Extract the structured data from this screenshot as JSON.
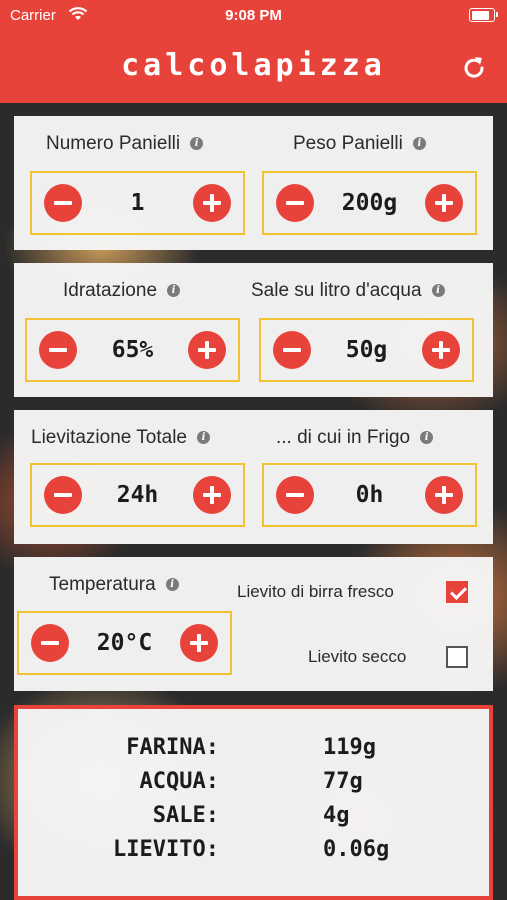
{
  "status_bar": {
    "carrier": "Carrier",
    "time": "9:08 PM",
    "battery_fill": 0.95
  },
  "header": {
    "title": "calcolapizza",
    "refresh_icon": "refresh-icon"
  },
  "settings": {
    "numero_panielli": {
      "label": "Numero Panielli",
      "value": "1"
    },
    "peso_panielli": {
      "label": "Peso Panielli",
      "value": "200g"
    },
    "idratazione": {
      "label": "Idratazione",
      "value": "65%"
    },
    "sale": {
      "label": "Sale su litro d'acqua",
      "value": "50g"
    },
    "lievitazione_totale": {
      "label": "Lievitazione Totale",
      "value": "24h"
    },
    "frigo": {
      "label": "... di cui in Frigo",
      "value": "0h"
    },
    "temperatura": {
      "label": "Temperatura",
      "value": "20°C"
    },
    "lievito_fresco": {
      "label": "Lievito di birra fresco",
      "checked": true
    },
    "lievito_secco": {
      "label": "Lievito secco",
      "checked": false
    }
  },
  "results": [
    {
      "key": "FARINA:",
      "value": "119g"
    },
    {
      "key": "ACQUA:",
      "value": "77g"
    },
    {
      "key": "SALE:",
      "value": "4g"
    },
    {
      "key": "LIEVITO:",
      "value": "0.06g"
    }
  ],
  "colors": {
    "accent": "#e8433b",
    "stepper_border": "#f1c232",
    "card_bg": "#f6f6f6"
  }
}
